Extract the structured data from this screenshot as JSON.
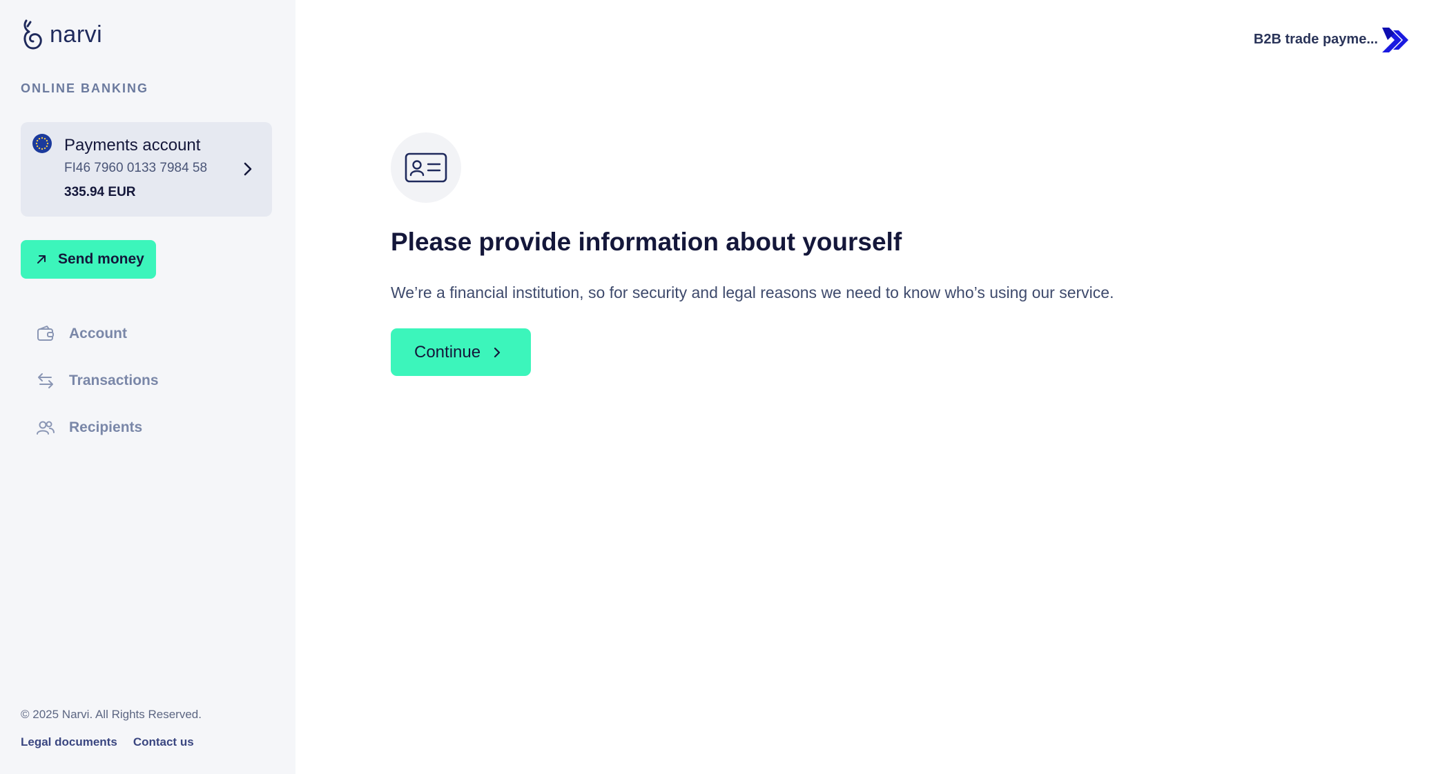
{
  "brand": {
    "name": "narvi",
    "section_label": "ONLINE BANKING"
  },
  "account_card": {
    "name": "Payments account",
    "iban": "FI46 7960 0133 7984 58",
    "balance": "335.94 EUR",
    "flag_icon": "eu-flag-icon"
  },
  "actions": {
    "send_money_label": "Send money"
  },
  "nav": {
    "items": [
      {
        "label": "Account",
        "icon": "wallet-icon"
      },
      {
        "label": "Transactions",
        "icon": "arrows-exchange-icon"
      },
      {
        "label": "Recipients",
        "icon": "users-icon"
      }
    ]
  },
  "footer": {
    "copyright": "© 2025 Narvi. All Rights Reserved.",
    "legal_label": "Legal documents",
    "contact_label": "Contact us"
  },
  "topbar": {
    "company_name": "B2B trade payme..."
  },
  "main": {
    "heading": "Please provide information about yourself",
    "description": "We’re a financial institution, so for security and legal reasons we need to know who’s using our service.",
    "continue_label": "Continue"
  },
  "colors": {
    "accent": "#3cf5bb",
    "sidebar_bg": "#f5f6f9",
    "card_bg": "#e6e9f1",
    "text_dark": "#14173a",
    "brand_blue": "#1a1ae0"
  }
}
